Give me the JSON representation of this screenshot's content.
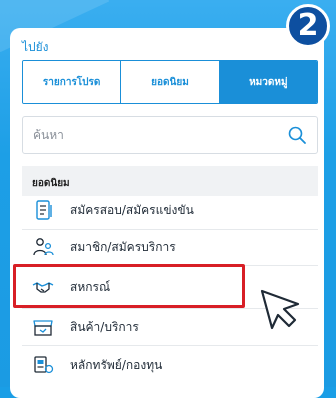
{
  "step_badge": "2",
  "panel": {
    "goto_label": "ไปยัง",
    "tabs": [
      {
        "label": "รายการโปรด",
        "active": false
      },
      {
        "label": "ยอดนิยม",
        "active": false
      },
      {
        "label": "หมวดหมู่",
        "active": true
      }
    ],
    "search": {
      "placeholder": "ค้นหา",
      "value": ""
    },
    "section_title": "ยอดนิยม",
    "menu_items": [
      {
        "label": "สมัครสอบ/สมัครแข่งขัน",
        "icon": "application-form-icon"
      },
      {
        "label": "สมาชิก/สมัครบริการ",
        "icon": "members-icon"
      },
      {
        "label": "สหกรณ์",
        "icon": "handshake-icon",
        "highlighted": true
      },
      {
        "label": "สินค้า/บริการ",
        "icon": "storefront-icon"
      },
      {
        "label": "หลักทรัพย์/กองทุน",
        "icon": "securities-icon"
      }
    ]
  },
  "colors": {
    "accent": "#1a8fd8",
    "highlight": "#d81f26",
    "background": "#1a9ee6",
    "badge": "#0d4fa0"
  }
}
